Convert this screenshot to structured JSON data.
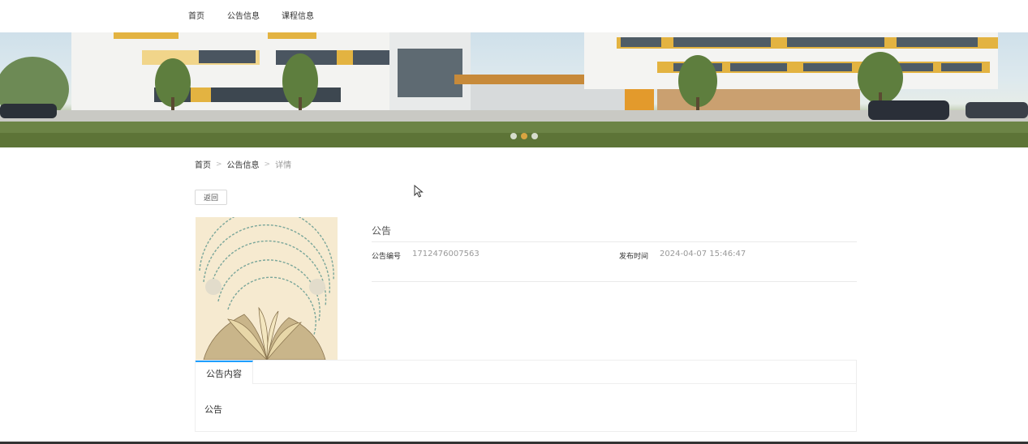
{
  "nav": {
    "items": [
      "首页",
      "公告信息",
      "课程信息"
    ]
  },
  "carousel": {
    "dots": 3,
    "active_index": 1,
    "accent_color": "#d9a441"
  },
  "breadcrumb": {
    "home": "首页",
    "section": "公告信息",
    "current": "详情",
    "separator": ">"
  },
  "back_button": "返回",
  "detail": {
    "title": "公告",
    "fields": [
      {
        "label": "公告编号",
        "value": "1712476007563"
      },
      {
        "label": "发布时间",
        "value": "2024-04-07 15:46:47"
      }
    ]
  },
  "content_panel": {
    "tab_label": "公告内容",
    "tab_accent": "#1e9fff",
    "body": "公告"
  }
}
